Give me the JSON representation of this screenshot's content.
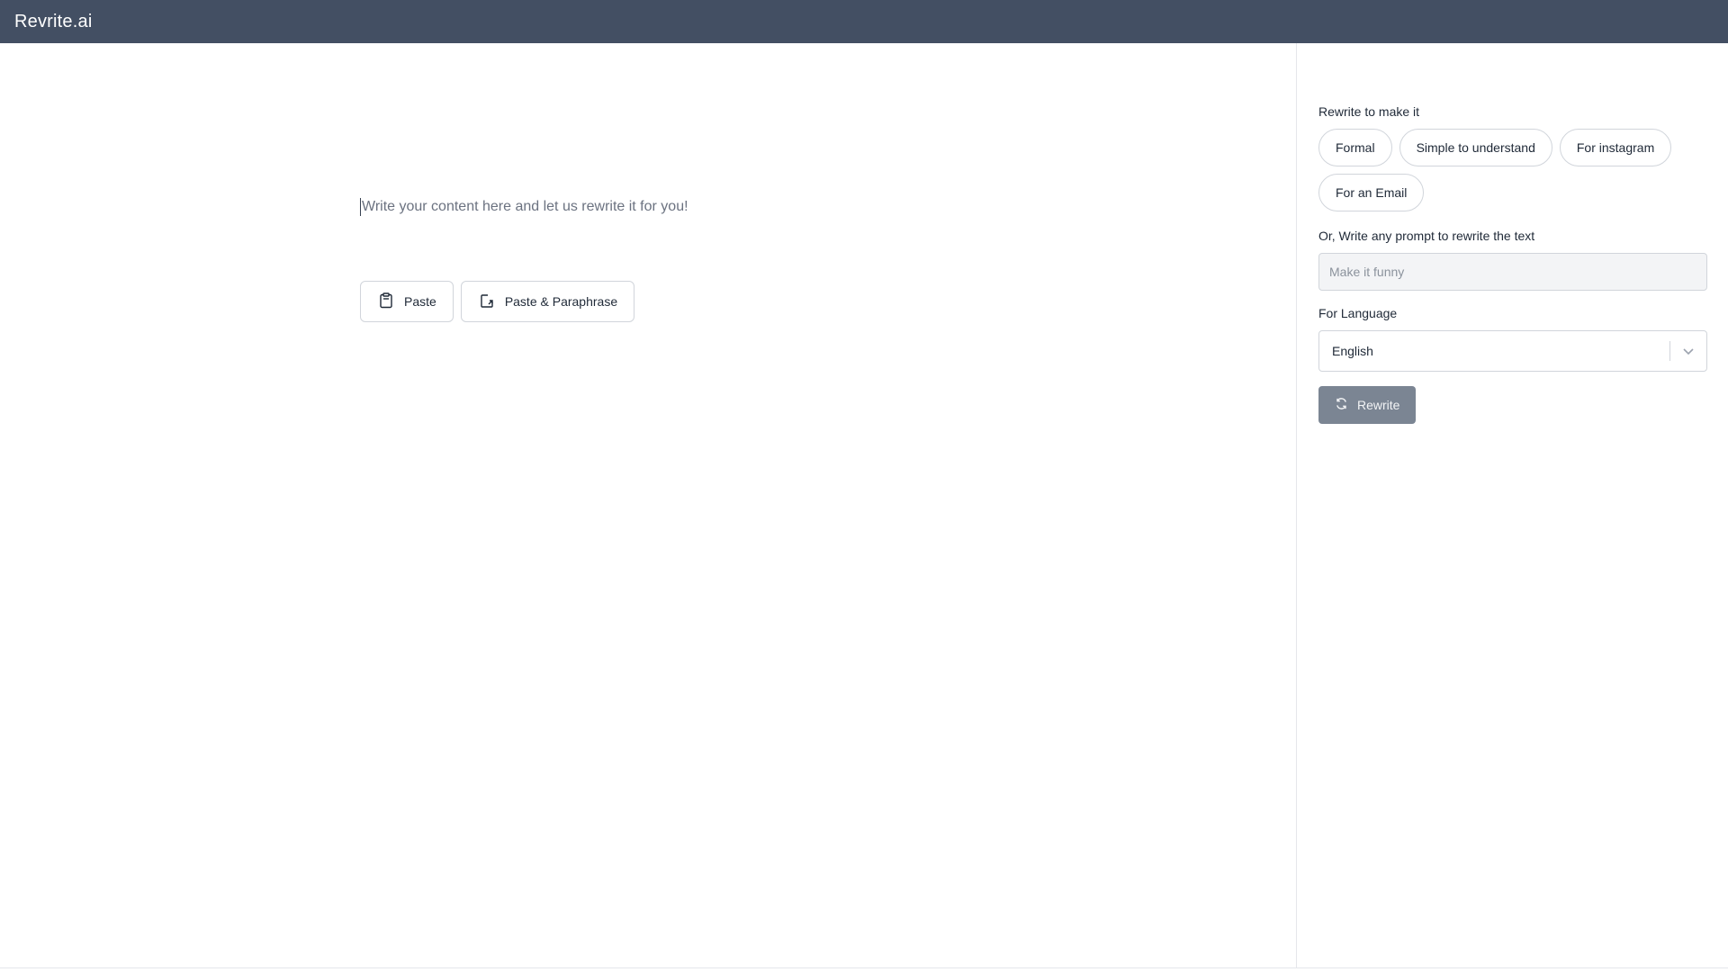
{
  "app": {
    "title": "Revrite.ai"
  },
  "editor": {
    "placeholder": "Write your content here and let us rewrite it for you!",
    "paste_label": "Paste",
    "paste_paraphrase_label": "Paste & Paraphrase"
  },
  "sidebar": {
    "rewrite_heading": "Rewrite to make it",
    "options": [
      "Formal",
      "Simple to understand",
      "For instagram",
      "For an Email"
    ],
    "prompt_label": "Or, Write any prompt to rewrite the text",
    "prompt_placeholder": "Make it funny",
    "language_label": "For Language",
    "language_selected": "English",
    "rewrite_button": "Rewrite"
  },
  "colors": {
    "topbar": "#434f63",
    "rewrite_button": "#7b8593"
  },
  "icons": {
    "paste": "clipboard-icon",
    "paste_paraphrase": "paste-export-icon",
    "dropdown": "chevron-down-icon",
    "rewrite": "refresh-icon"
  }
}
